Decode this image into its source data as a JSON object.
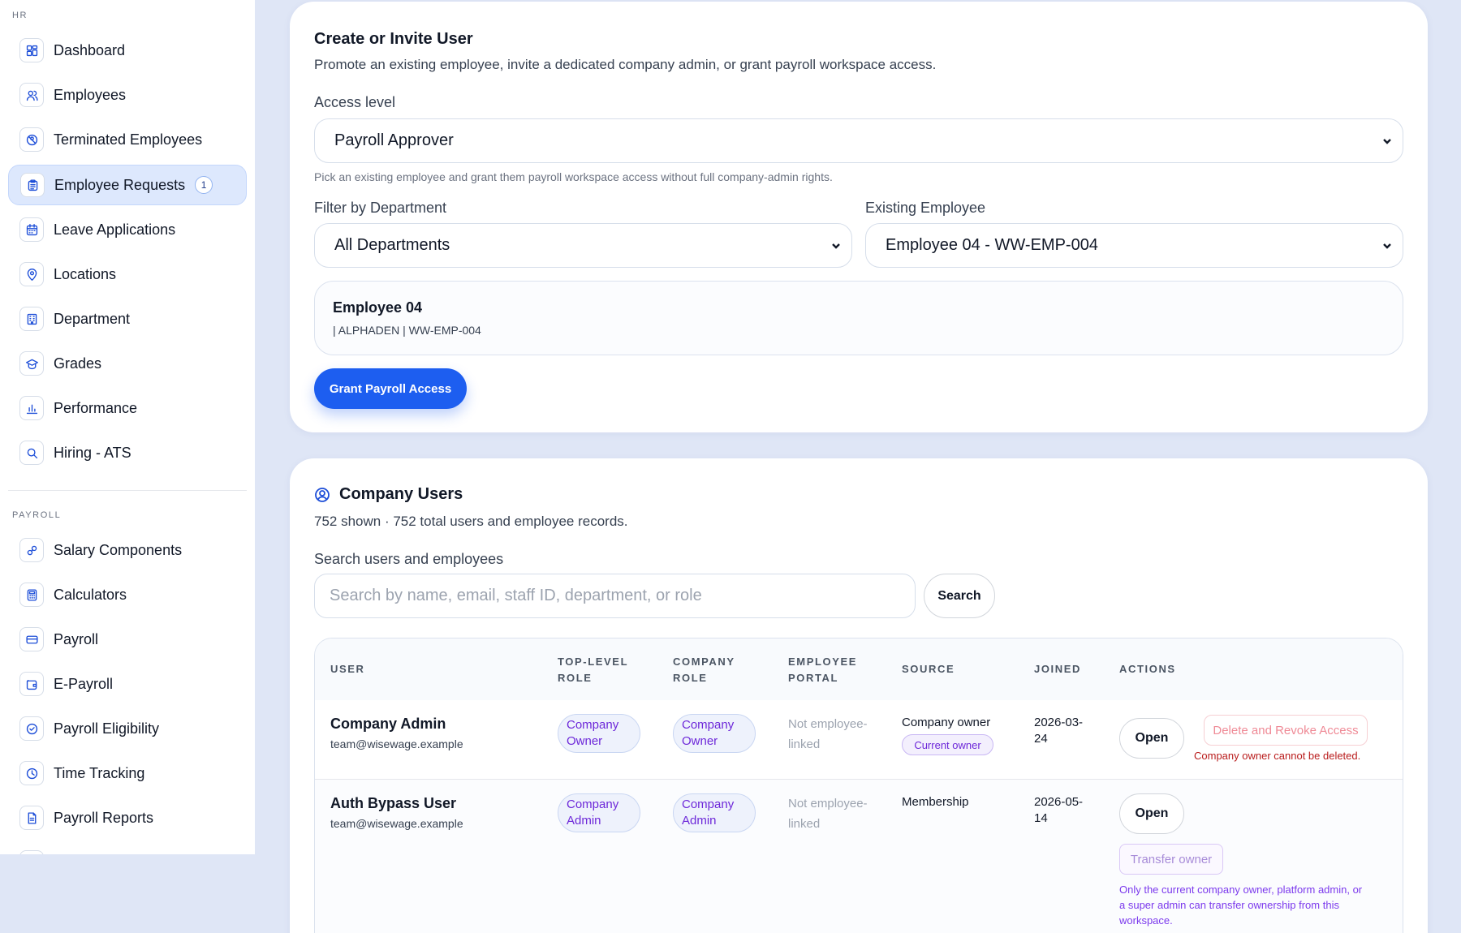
{
  "sidebar": {
    "sections": [
      {
        "label": "HR",
        "items": [
          {
            "label": "Dashboard",
            "icon": "dashboard-icon"
          },
          {
            "label": "Employees",
            "icon": "users-icon"
          },
          {
            "label": "Terminated Employees",
            "icon": "user-off-icon"
          },
          {
            "label": "Employee Requests",
            "icon": "clipboard-icon",
            "badge": "1",
            "active": true
          },
          {
            "label": "Leave Applications",
            "icon": "calendar-icon"
          },
          {
            "label": "Locations",
            "icon": "map-pin-icon"
          },
          {
            "label": "Department",
            "icon": "building-icon"
          },
          {
            "label": "Grades",
            "icon": "graduation-cap-icon"
          },
          {
            "label": "Performance",
            "icon": "bar-chart-icon"
          },
          {
            "label": "Hiring - ATS",
            "icon": "search-icon"
          }
        ]
      },
      {
        "label": "PAYROLL",
        "items": [
          {
            "label": "Salary Components",
            "icon": "components-icon"
          },
          {
            "label": "Calculators",
            "icon": "calculator-icon"
          },
          {
            "label": "Payroll",
            "icon": "credit-card-icon"
          },
          {
            "label": "E-Payroll",
            "icon": "wallet-icon"
          },
          {
            "label": "Payroll Eligibility",
            "icon": "check-circle-icon"
          },
          {
            "label": "Time Tracking",
            "icon": "clock-icon"
          },
          {
            "label": "Payroll Reports",
            "icon": "file-report-icon"
          }
        ]
      }
    ]
  },
  "invite": {
    "title": "Create or Invite User",
    "subtitle": "Promote an existing employee, invite a dedicated company admin, or grant payroll workspace access.",
    "access_level_label": "Access level",
    "access_level_value": "Payroll Approver",
    "access_hint": "Pick an existing employee and grant them payroll workspace access without full company-admin rights.",
    "department_label": "Filter by Department",
    "department_value": "All Departments",
    "employee_label": "Existing Employee",
    "employee_value": "Employee 04 - WW-EMP-004",
    "selected_employee": {
      "name": "Employee 04",
      "meta": "| ALPHADEN | WW-EMP-004"
    },
    "grant_button": "Grant Payroll Access"
  },
  "users": {
    "title": "Company Users",
    "summary": "752 shown · 752 total users and employee records.",
    "search_label": "Search users and employees",
    "search_placeholder": "Search by name, email, staff ID, department, or role",
    "search_button": "Search",
    "columns": {
      "user": "USER",
      "top_role_1": "TOP-LEVEL",
      "top_role_2": "ROLE",
      "company_role_1": "COMPANY",
      "company_role_2": "ROLE",
      "portal_1": "EMPLOYEE",
      "portal_2": "PORTAL",
      "source": "SOURCE",
      "joined": "JOINED",
      "actions": "ACTIONS"
    },
    "rows": [
      {
        "name": "Company Admin",
        "email": "team@wisewage.example",
        "top_role_1": "Company",
        "top_role_2": "Owner",
        "company_role_1": "Company",
        "company_role_2": "Owner",
        "portal_1": "Not employee-",
        "portal_2": "linked",
        "source": "Company owner",
        "source_badge": "Current owner",
        "joined_1": "2026-03-",
        "joined_2": "24",
        "open_button": "Open",
        "delete_button": "Delete and Revoke Access",
        "delete_note": "Company owner cannot be deleted."
      },
      {
        "name": "Auth Bypass User",
        "email": "team@wisewage.example",
        "top_role_1": "Company",
        "top_role_2": "Admin",
        "company_role_1": "Company",
        "company_role_2": "Admin",
        "portal_1": "Not employee-",
        "portal_2": "linked",
        "source": "Membership",
        "joined_1": "2026-05-",
        "joined_2": "14",
        "open_button": "Open",
        "transfer_button": "Transfer owner",
        "transfer_note_1": "Only the current company owner, platform admin, or",
        "transfer_note_2": "a super admin can transfer ownership from this",
        "transfer_note_3": "workspace."
      }
    ]
  },
  "colors": {
    "accent": "#1d5ef0",
    "page_bg": "#dfe6f6",
    "role_text": "#6d28d9",
    "danger": "#b91c1c"
  }
}
